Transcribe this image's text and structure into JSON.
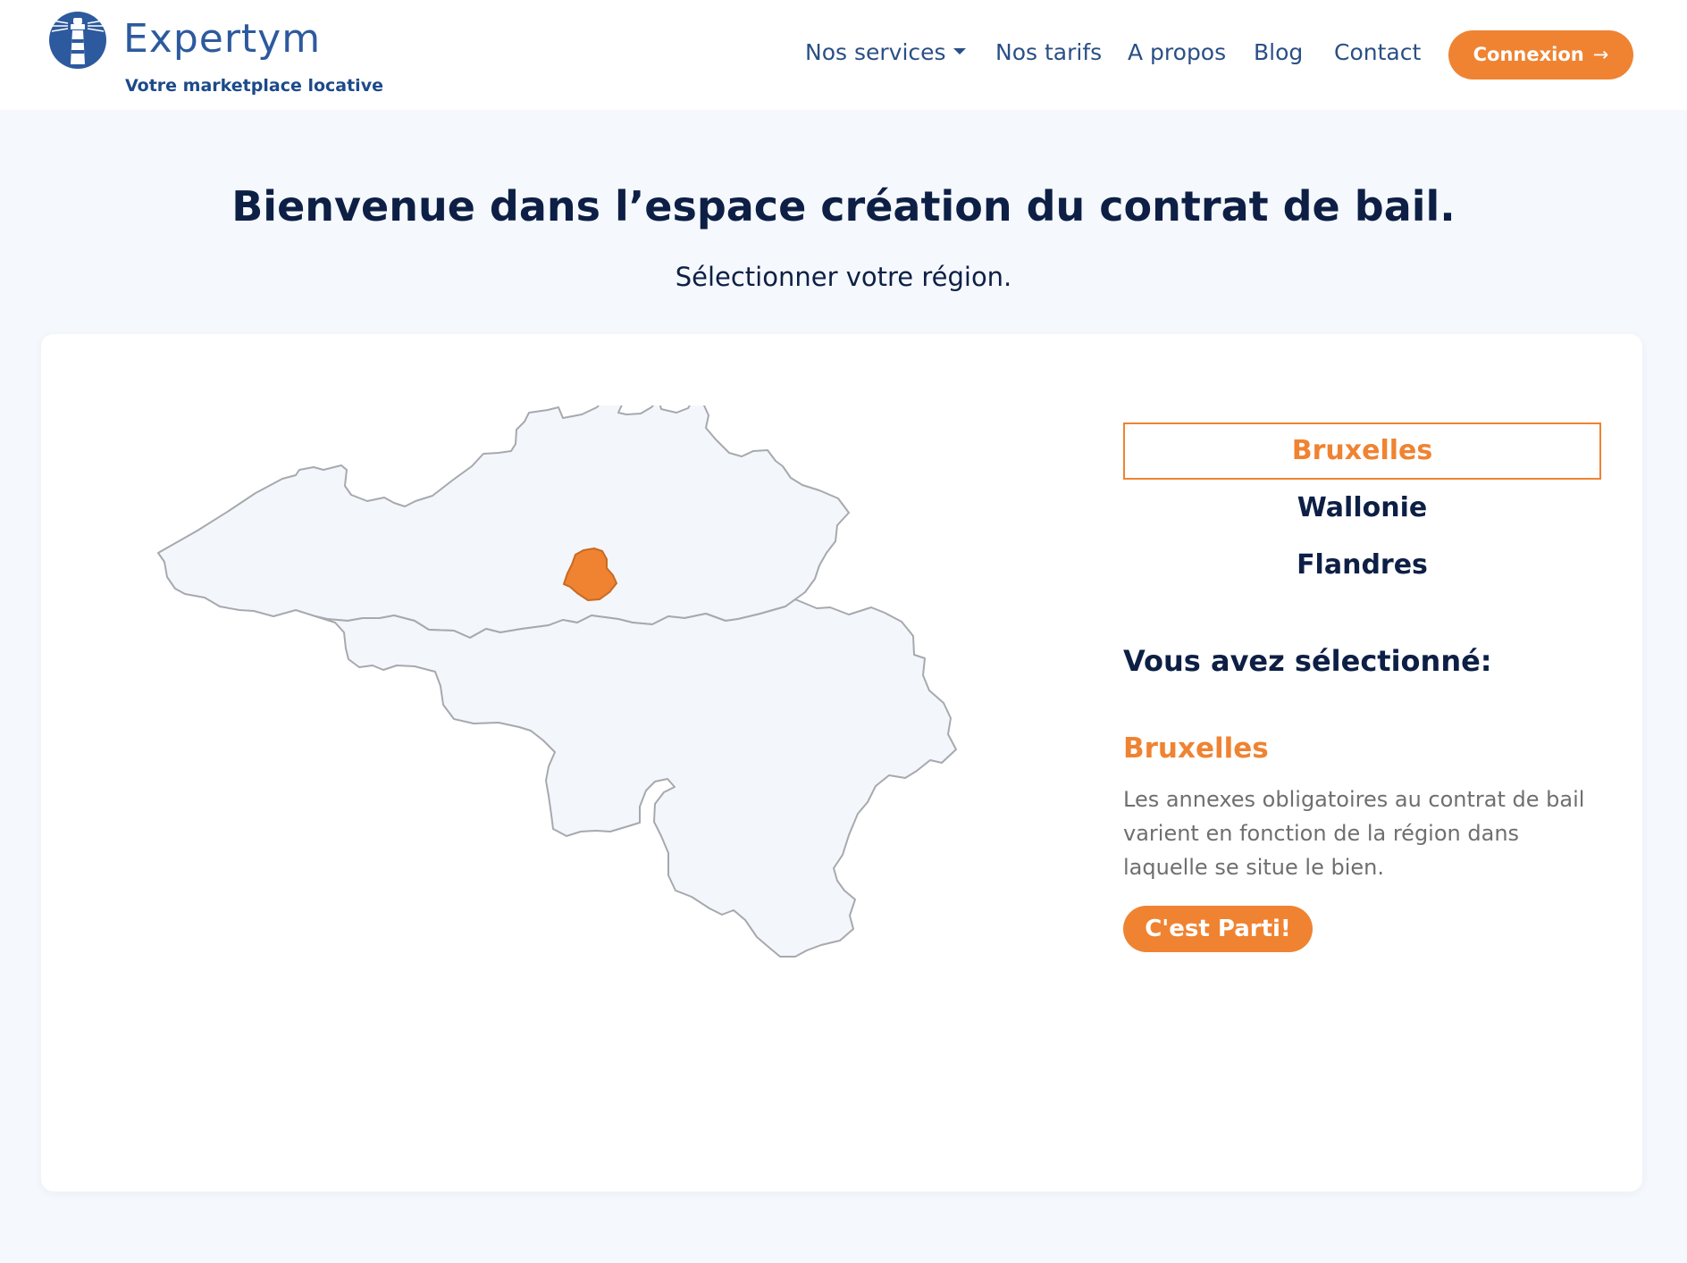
{
  "brand": {
    "name": "Expertym",
    "tagline": "Votre marketplace locative",
    "logo_icon": "lighthouse-icon",
    "primary_color": "#2d5a9e",
    "accent_color": "#ef8332"
  },
  "nav": {
    "services": "Nos services",
    "pricing": "Nos tarifs",
    "about": "A propos",
    "blog": "Blog",
    "contact": "Contact",
    "login": "Connexion",
    "login_icon": "arrow-right-icon",
    "services_icon": "caret-down-icon"
  },
  "page": {
    "title": "Bienvenue dans l’espace création du contrat de bail.",
    "subtitle": "Sélectionner votre région."
  },
  "regions": {
    "items": [
      {
        "label": "Bruxelles",
        "active": true
      },
      {
        "label": "Wallonie",
        "active": false
      },
      {
        "label": "Flandres",
        "active": false
      }
    ],
    "map_highlight_color": "#ef8332",
    "map_fill_color": "#f3f6fb"
  },
  "selection": {
    "heading": "Vous avez sélectionné:",
    "value": "Bruxelles",
    "description": "Les annexes obligatoires au contrat de bail varient en fonction de la région dans laquelle se situe le bien.",
    "cta": "C'est Parti!"
  }
}
